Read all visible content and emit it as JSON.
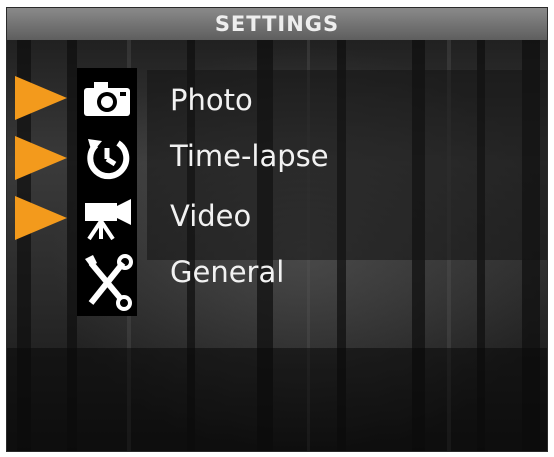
{
  "header": {
    "title": "SETTINGS"
  },
  "menu": {
    "items": [
      {
        "label": "Photo",
        "icon": "camera-icon",
        "arrow": true
      },
      {
        "label": "Time-lapse",
        "icon": "timer-icon",
        "arrow": true
      },
      {
        "label": "Video",
        "icon": "video-camera-icon",
        "arrow": true
      },
      {
        "label": "General",
        "icon": "tools-icon",
        "arrow": false
      }
    ]
  },
  "colors": {
    "accent": "#f39a1c",
    "title_bar": "#6e6e6e",
    "text": "#f2f2f2"
  }
}
